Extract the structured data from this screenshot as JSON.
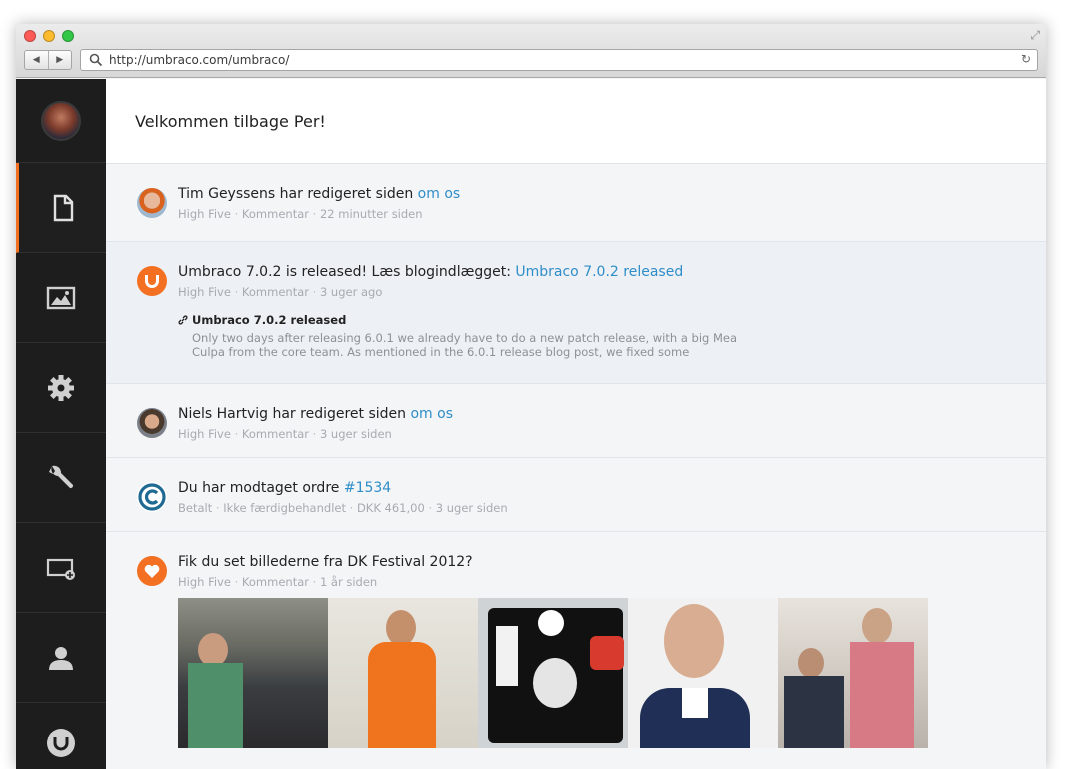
{
  "browser": {
    "url": "http://umbraco.com/umbraco/"
  },
  "header": {
    "title": "Velkommen tilbage Per!"
  },
  "sidebar": {
    "items": [
      {
        "name": "content",
        "icon": "document-icon",
        "active": true
      },
      {
        "name": "media",
        "icon": "image-icon",
        "active": false
      },
      {
        "name": "settings",
        "icon": "gear-icon",
        "active": false
      },
      {
        "name": "developer",
        "icon": "wrench-icon",
        "active": false
      },
      {
        "name": "forms",
        "icon": "screen-add-icon",
        "active": false
      },
      {
        "name": "users",
        "icon": "user-icon",
        "active": false
      },
      {
        "name": "umbraco",
        "icon": "umbraco-logo-icon",
        "active": false
      }
    ]
  },
  "feed": [
    {
      "title_text": "Tim Geyssens har redigeret siden ",
      "title_link": "om os",
      "meta": [
        "High Five",
        "Kommentar",
        "22 minutter siden"
      ]
    },
    {
      "title_text": "Umbraco 7.0.2 is released! Læs blogindlægget: ",
      "title_link": "Umbraco 7.0.2 released",
      "meta": [
        "High Five",
        "Kommentar",
        "3 uger ago"
      ],
      "blog": {
        "title": "Umbraco 7.0.2 released",
        "excerpt": "Only two days after releasing 6.0.1 we already have to do a new patch release, with a big Mea Culpa from the core team. As mentioned in the 6.0.1 release blog post, we fixed some"
      }
    },
    {
      "title_text": "Niels Hartvig har redigeret siden ",
      "title_link": "om os",
      "meta": [
        "High Five",
        "Kommentar",
        "3 uger siden"
      ]
    },
    {
      "title_text": "Du har modtaget ordre ",
      "title_link": "#1534",
      "meta": [
        "Betalt",
        "Ikke færdigbehandlet",
        "DKK 461,00",
        "3 uger siden"
      ]
    },
    {
      "title_text": "Fik du set billederne fra DK Festival 2012?",
      "title_link": "",
      "meta": [
        "High Five",
        "Kommentar",
        "1 år siden"
      ]
    }
  ],
  "colors": {
    "accent": "#f36f21",
    "link": "#2f8dc8",
    "sidebar": "#1d1d1d"
  }
}
